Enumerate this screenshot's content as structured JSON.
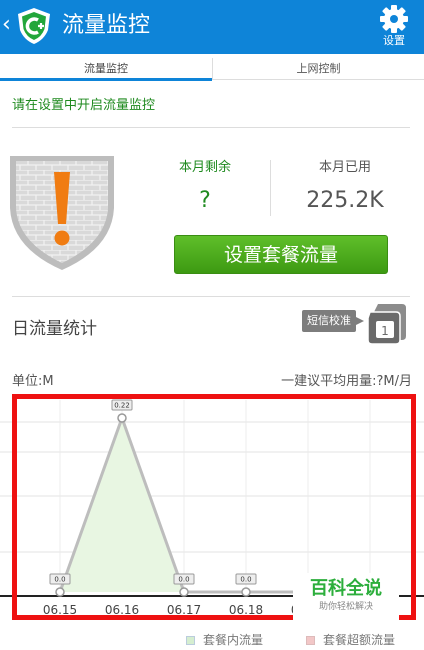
{
  "header": {
    "back_glyph": "‹",
    "title": "流量监控",
    "settings_label": "设置",
    "icons": {
      "logo": "shield-plus-icon",
      "settings": "gear-icon"
    },
    "colors": {
      "bar": "#0e84d8",
      "logo_green": "#22a63a"
    }
  },
  "tabs": [
    {
      "label": "流量监控",
      "active": true
    },
    {
      "label": "上网控制",
      "active": false
    }
  ],
  "notice": "请在设置中开启流量监控",
  "stats": {
    "remaining_label": "本月剩余",
    "remaining_value": "?",
    "used_label": "本月已用",
    "used_value": "225.2K"
  },
  "plan_button": "设置套餐流量",
  "daily": {
    "title": "日流量统计",
    "sms_button": "短信校准",
    "sim_icon": "sim-card-icon"
  },
  "chart_meta": {
    "unit": "单位:M",
    "avg": "一建议平均用量:?M/月"
  },
  "chart_data": {
    "type": "area",
    "categories": [
      "06.15",
      "06.16",
      "06.17",
      "06.18",
      "06.19",
      "06.20"
    ],
    "series": [
      {
        "name": "套餐内流量",
        "values": [
          0.0,
          0.22,
          0.0,
          0.0,
          0.0,
          0.0
        ],
        "labels": [
          "0.0",
          "0.22",
          "0.0",
          "0.0",
          "0.0",
          "0.0"
        ]
      }
    ],
    "ylim": [
      0,
      0.22
    ],
    "grid": true,
    "colors": {
      "line": "#bdbdbd",
      "fill": "#e8f6e2",
      "box": "#ee1111"
    }
  },
  "watermark": {
    "title": "百科全说",
    "subtitle": "助你轻松解决"
  },
  "legend": [
    {
      "label": "套餐内流量",
      "color": "#d5eed0"
    },
    {
      "label": "套餐超额流量",
      "color": "#f2c7c7"
    }
  ]
}
